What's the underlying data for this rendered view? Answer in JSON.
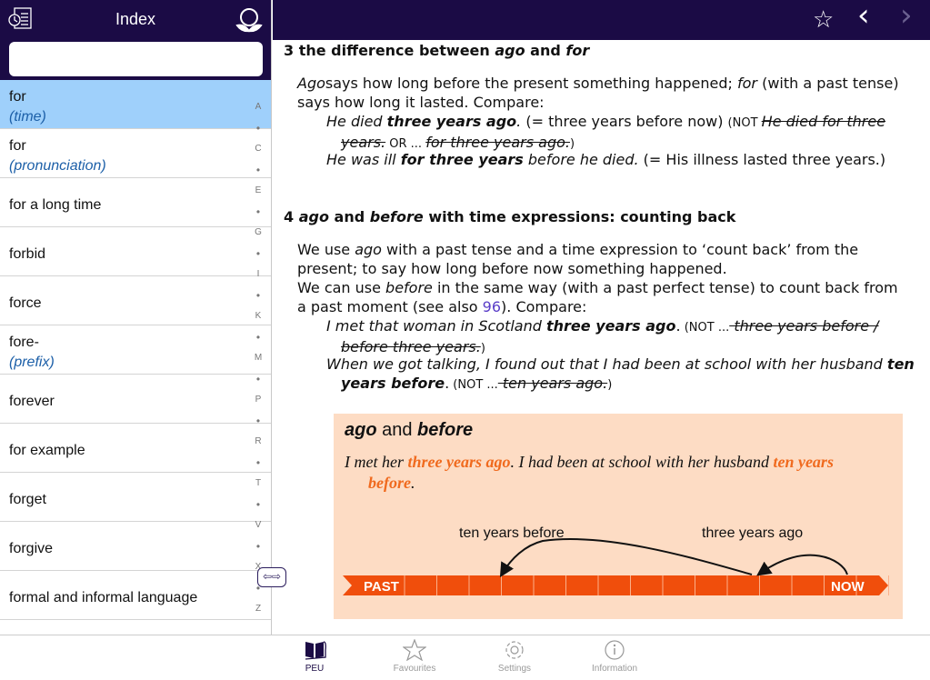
{
  "sidebar": {
    "title": "Index",
    "search": {
      "value": "",
      "placeholder": ""
    },
    "items": [
      {
        "label": "for",
        "sub": "(time)",
        "selected": true
      },
      {
        "label": "for",
        "sub": "(pronunciation)"
      },
      {
        "label": "for a long time"
      },
      {
        "label": "forbid"
      },
      {
        "label": "force"
      },
      {
        "label": "fore-",
        "sub": "(prefix)"
      },
      {
        "label": "forever"
      },
      {
        "label": "for example"
      },
      {
        "label": "forget"
      },
      {
        "label": "forgive"
      },
      {
        "label": "formal and informal language"
      }
    ],
    "rail": [
      "A",
      "•",
      "C",
      "•",
      "E",
      "•",
      "G",
      "•",
      "I",
      "•",
      "K",
      "•",
      "M",
      "•",
      "P",
      "•",
      "R",
      "•",
      "T",
      "•",
      "V",
      "•",
      "X",
      "•",
      "Z"
    ],
    "splitter": "⇦⇨"
  },
  "toolbar": {
    "favourite": "☆",
    "back": "‹",
    "forward": "›"
  },
  "content": {
    "s3": {
      "num": "3",
      "a": " the difference between ",
      "b": "ago",
      "c": " and ",
      "d": "for"
    },
    "p3": [
      [
        "i",
        "Ago"
      ],
      [
        "",
        "says how long before the present something happened; "
      ],
      [
        "i",
        "for"
      ],
      [
        "",
        " (with a past tense) says how long it lasted. Compare:"
      ]
    ],
    "ex3a": [
      [
        "i",
        "He died "
      ],
      [
        "bi",
        "three years ago"
      ],
      [
        "i",
        "."
      ],
      [
        "",
        " (= three years before now) "
      ],
      [
        "sm",
        "(NOT "
      ],
      [
        "si",
        "He died for three years."
      ],
      [
        "sm",
        " OR ... "
      ],
      [
        "si",
        "for three years ago."
      ],
      [
        "sm",
        ")"
      ]
    ],
    "ex3b": [
      [
        "i",
        "He was ill "
      ],
      [
        "bi",
        "for three years"
      ],
      [
        "i",
        " before he died."
      ],
      [
        "",
        " (= His illness lasted three years.)"
      ]
    ],
    "s4": {
      "num": "4",
      "a": " ",
      "b": "ago",
      "c": " and ",
      "d": "before",
      "e": " with time expressions: counting back"
    },
    "p4a": [
      [
        "",
        "We use "
      ],
      [
        "i",
        "ago"
      ],
      [
        "",
        " with a past tense and a time expression to ‘count back’ from the present; to say how long before now something happened."
      ]
    ],
    "p4b": [
      [
        "",
        "We can use "
      ],
      [
        "i",
        "before"
      ],
      [
        "",
        " in the same way (with a past perfect tense) to count back from a past moment (see also "
      ],
      [
        "link",
        "96"
      ],
      [
        "",
        "). Compare:"
      ]
    ],
    "ex4a": [
      [
        "i",
        "I met that woman in Scotland "
      ],
      [
        "bi",
        "three years ago"
      ],
      [
        "",
        "."
      ],
      [
        "sm",
        " (NOT ..."
      ],
      [
        "si",
        " three years before / before three years."
      ],
      [
        "sm",
        ")"
      ]
    ],
    "ex4b": [
      [
        "i",
        "When we got talking, I found out that I had been at school with her husband "
      ],
      [
        "bi",
        "ten years before"
      ],
      [
        "",
        "."
      ],
      [
        "sm",
        " (NOT ..."
      ],
      [
        "si",
        " ten years ago."
      ],
      [
        "sm",
        ")"
      ]
    ],
    "box": {
      "title_a": "ago",
      "title_b": " and ",
      "title_c": "before",
      "sent": [
        [
          "",
          "I met her "
        ],
        [
          "or",
          "three years ago"
        ],
        [
          "",
          ". I had been at school with her husband "
        ],
        [
          "or",
          "ten years before"
        ],
        [
          "",
          "."
        ]
      ],
      "label_ten": "ten years before",
      "label_three": "three years ago",
      "past": "PAST",
      "now": "NOW"
    }
  },
  "colors": {
    "nav": "#1b0b45",
    "selected": "#9fd0fb",
    "accent_orange": "#f04e0c",
    "box_bg": "#fddcc4",
    "link": "#5a3ec8"
  },
  "tabs": [
    {
      "label": "PEU",
      "icon": "book-icon",
      "active": true
    },
    {
      "label": "Favourites",
      "icon": "star-icon"
    },
    {
      "label": "Settings",
      "icon": "gear-icon"
    },
    {
      "label": "Information",
      "icon": "info-icon"
    }
  ]
}
